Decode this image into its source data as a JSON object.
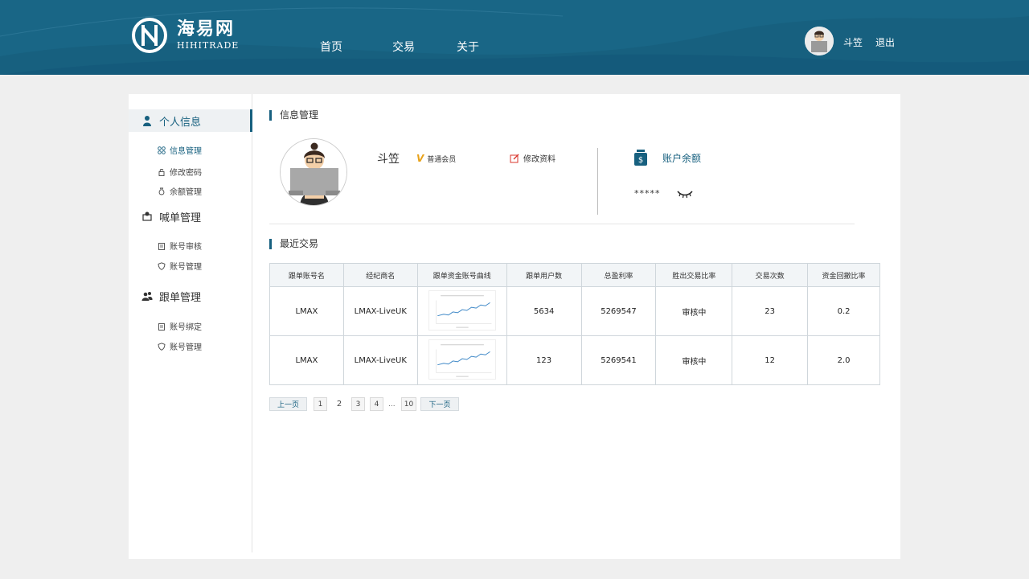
{
  "header": {
    "logo_cn": "海易网",
    "logo_en": "HIHITRADE",
    "nav": [
      "首页",
      "交易",
      "关于"
    ],
    "user_name": "斗笠",
    "logout": "退出"
  },
  "sidebar": {
    "sections": [
      {
        "label": "个人信息",
        "icon": "person-icon",
        "items": [
          {
            "label": "信息管理",
            "icon": "grid-icon"
          },
          {
            "label": "修改密码",
            "icon": "lock-icon"
          },
          {
            "label": "余额管理",
            "icon": "money-bag-icon"
          }
        ]
      },
      {
        "label": "喊单管理",
        "icon": "announce-icon",
        "items": [
          {
            "label": "账号审核",
            "icon": "clipboard-icon"
          },
          {
            "label": "账号管理",
            "icon": "shield-icon"
          }
        ]
      },
      {
        "label": "跟单管理",
        "icon": "group-icon",
        "items": [
          {
            "label": "账号绑定",
            "icon": "clipboard-icon"
          },
          {
            "label": "账号管理",
            "icon": "shield-icon"
          }
        ]
      }
    ]
  },
  "info": {
    "title": "信息管理",
    "name": "斗笠",
    "member": "普通会员",
    "edit": "修改资料",
    "balance_title": "账户余额",
    "balance_value": "*****"
  },
  "trades": {
    "title": "最近交易",
    "columns": [
      "跟单账号名",
      "经纪商名",
      "跟单资金账号曲线",
      "跟单用户数",
      "总盈利率",
      "胜出交易比率",
      "交易次数",
      "资金回撤比率"
    ],
    "rows": [
      [
        "LMAX",
        "LMAX-LiveUK",
        "",
        "5634",
        "5269547",
        "审核中",
        "23",
        "0.2"
      ],
      [
        "LMAX",
        "LMAX-LiveUK",
        "",
        "123",
        "5269541",
        "审核中",
        "12",
        "2.0"
      ]
    ]
  },
  "pager": {
    "prev": "上一页",
    "next": "下一页",
    "pages": [
      "1",
      "2",
      "3",
      "4"
    ],
    "ellipsis": "...",
    "last": "10",
    "current": "2"
  },
  "colors": {
    "brand": "#17607f",
    "member_v": "#e8a21a",
    "edit_icon": "#d9342b"
  }
}
